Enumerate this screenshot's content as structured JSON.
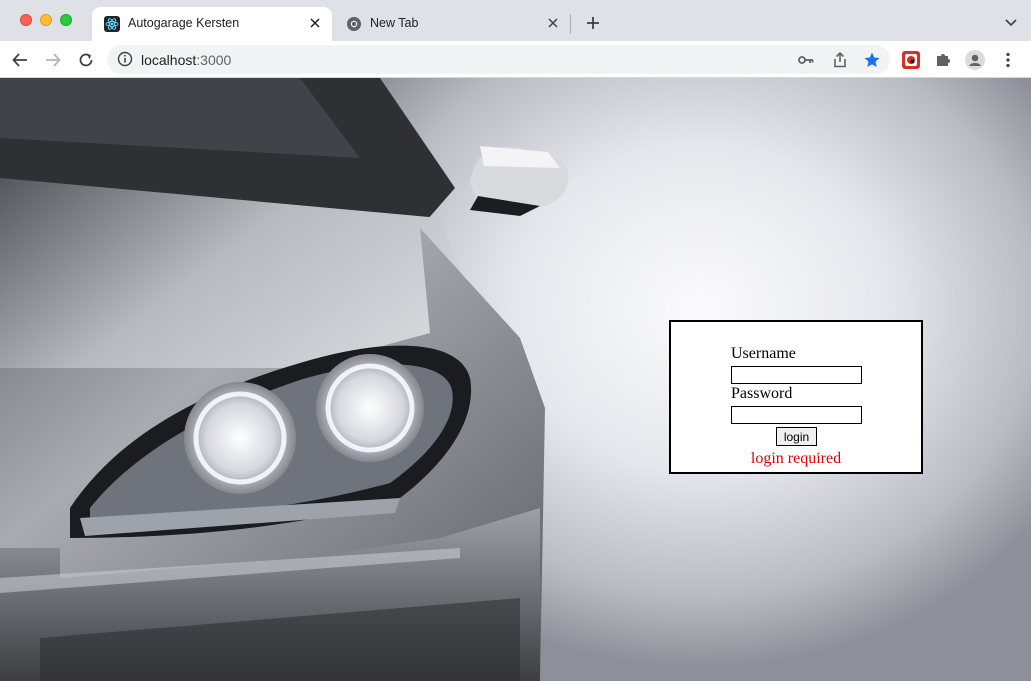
{
  "browser": {
    "tabs": [
      {
        "title": "Autogarage Kersten",
        "active": true,
        "icon": "react-icon"
      },
      {
        "title": "New Tab",
        "active": false,
        "icon": "chrome-icon"
      }
    ],
    "address": {
      "host": "localhost",
      "port": ":3000"
    },
    "colors": {
      "star": "#1a73e8",
      "extension": "#d93025"
    }
  },
  "page": {
    "login": {
      "username_label": "Username",
      "password_label": "Password",
      "username_value": "",
      "password_value": "",
      "button_label": "login",
      "status_message": "login required",
      "status_color": "#e00000"
    }
  }
}
